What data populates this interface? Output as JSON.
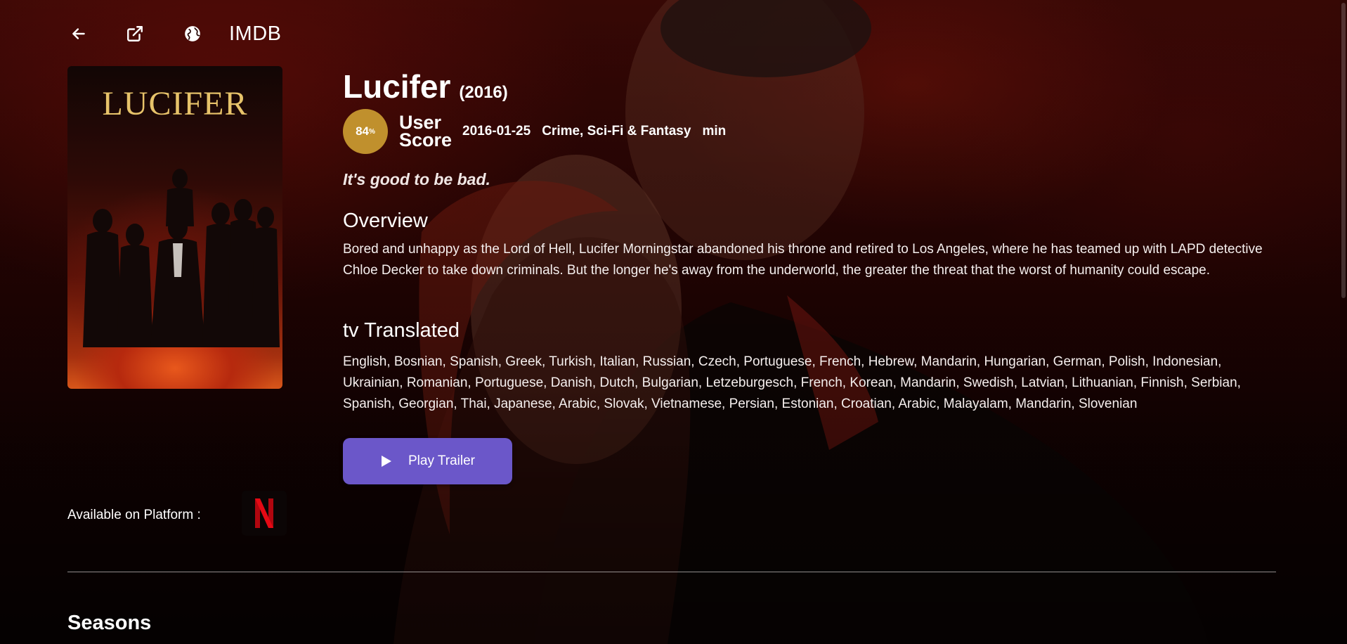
{
  "colors": {
    "accent_button": "#6b57c9",
    "score_badge": "#c0902d",
    "background": "#240403",
    "netflix_red": "#e50914"
  },
  "topbar": {
    "back_icon": "arrow-left-icon",
    "external_icon": "external-link-icon",
    "globe_icon": "globe-icon",
    "imdb_label": "IMDB"
  },
  "poster": {
    "title_text": "LUCIFER"
  },
  "show": {
    "title": "Lucifer",
    "year": "(2016)",
    "score_value": "84",
    "score_unit": "%",
    "score_label": "User Score",
    "release_date": "2016-01-25",
    "genres": "Crime, Sci-Fi & Fantasy",
    "runtime": "min",
    "tagline": "It's good to be bad.",
    "overview_heading": "Overview",
    "overview": "Bored and unhappy as the Lord of Hell, Lucifer Morningstar abandoned his throne and retired to Los Angeles, where he has teamed up with LAPD detective Chloe Decker to take down criminals. But the longer he's away from the underworld, the greater the threat that the worst of humanity could escape.",
    "translated_heading": "tv Translated",
    "languages": "English, Bosnian, Spanish, Greek, Turkish, Italian, Russian, Czech, Portuguese, French, Hebrew, Mandarin, Hungarian, German, Polish, Indonesian, Ukrainian, Romanian, Portuguese, Danish, Dutch, Bulgarian, Letzeburgesch, French, Korean, Mandarin, Swedish, Latvian, Lithuanian, Finnish, Serbian, Spanish, Georgian, Thai, Japanese, Arabic, Slovak, Vietnamese, Persian, Estonian, Croatian, Arabic, Malayalam, Mandarin, Slovenian"
  },
  "actions": {
    "play_icon": "play-icon",
    "play_trailer_label": "Play Trailer"
  },
  "platform": {
    "label": "Available on Platform :",
    "logo_icon": "netflix-logo-icon"
  },
  "sections": {
    "seasons_heading": "Seasons"
  }
}
